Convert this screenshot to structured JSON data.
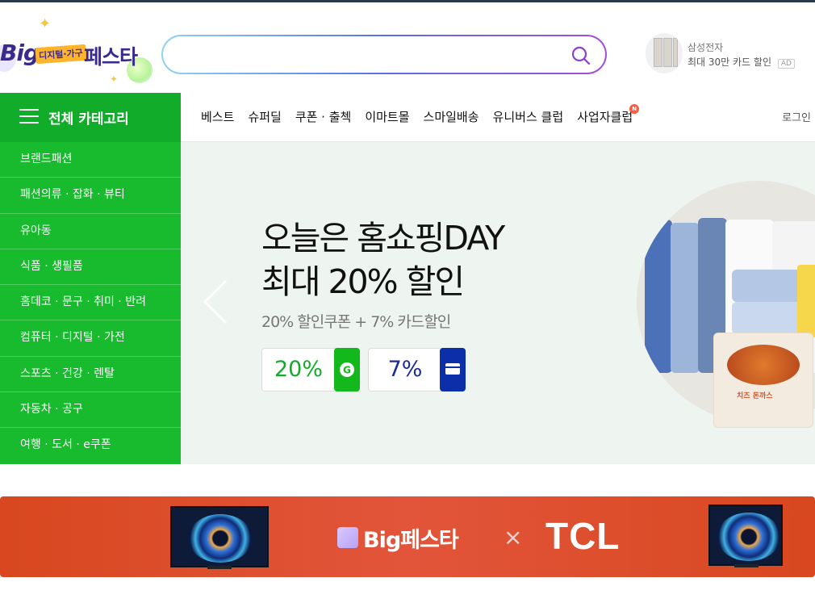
{
  "header": {
    "logo": {
      "big": "Big",
      "tag": "디지털·가구",
      "festa": "페스타"
    },
    "search": {
      "placeholder": "",
      "value": ""
    },
    "ad": {
      "brand": "삼성전자",
      "text": "최대 30만 카드 할인",
      "badge": "AD"
    }
  },
  "nav": {
    "category_button": "전체 카테고리",
    "items": [
      {
        "label": "베스트"
      },
      {
        "label": "슈퍼딜"
      },
      {
        "label": "쿠폰 · 출첵"
      },
      {
        "label": "이마트몰"
      },
      {
        "label": "스마일배송"
      },
      {
        "label": "유니버스 클럽"
      },
      {
        "label": "사업자클럽",
        "badge": "N"
      }
    ],
    "login": "로그인"
  },
  "sidebar": {
    "items": [
      "브랜드패션",
      "패션의류 · 잡화 · 뷰티",
      "유아동",
      "식품 · 생필품",
      "홈데코 · 문구 · 취미 · 반려",
      "컴퓨터 · 디지털 · 가전",
      "스포츠 · 건강 · 렌탈",
      "자동차 · 공구",
      "여행 · 도서 · e쿠폰"
    ]
  },
  "hero": {
    "title_line1": "오늘은 홈쇼핑DAY",
    "title_line2": "최대 20% 할인",
    "subtitle": "20% 할인쿠폰 + 7% 카드할인",
    "badge1": "20%",
    "badge2": "7%",
    "product_label": "치즈 돈까스"
  },
  "promo": {
    "logo": "Big페스타",
    "x": "×",
    "partner": "TCL"
  },
  "colors": {
    "green": "#11ac2a",
    "sidebar_green": "#17bb2d",
    "promo_orange": "#d8471f",
    "card_blue": "#0c2ea8"
  }
}
